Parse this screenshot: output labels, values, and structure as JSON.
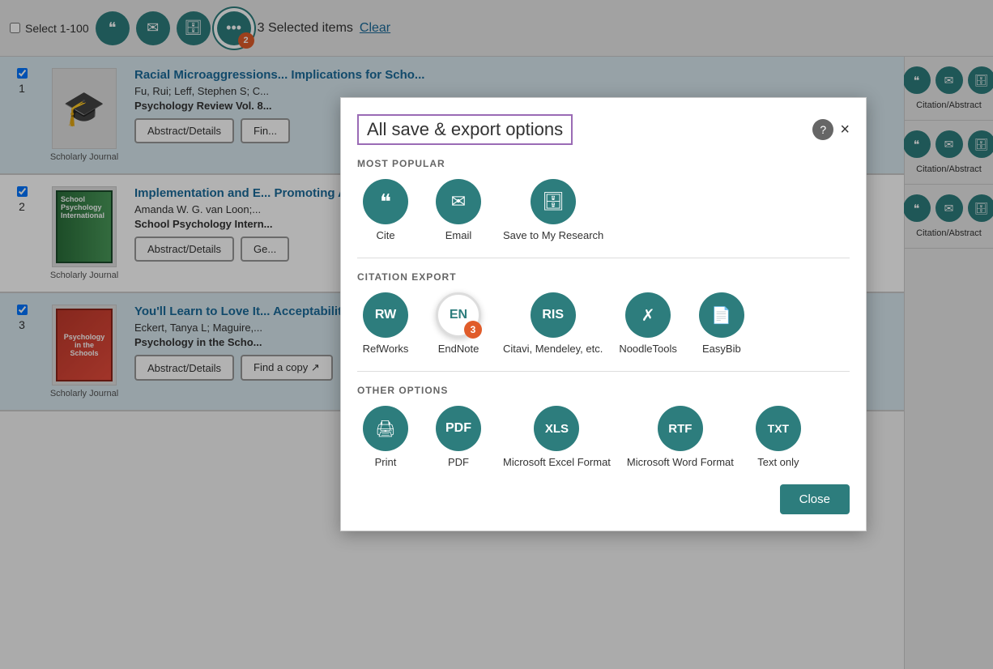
{
  "toolbar": {
    "select_label": "Select 1-100",
    "cite_icon": "❝",
    "email_icon": "✉",
    "save_icon": "🗄",
    "more_icon": "•••",
    "more_badge": "2",
    "selected_count": "3 Selected items",
    "clear_label": "Clear"
  },
  "results": [
    {
      "num": "1",
      "checked": true,
      "title": "Racial Microaggressions... Implications for Scho...",
      "authors": "Fu, Rui; Leff, Stephen S; C...",
      "source": "Psychology Review Vol. 8...",
      "type_label": "Scholarly Journal",
      "buttons": [
        "Abstract/Details",
        "Fin..."
      ]
    },
    {
      "num": "2",
      "checked": true,
      "title": "Implementation and E... Promoting Adolescen...",
      "authors": "Amanda W. G. van Loon;...",
      "source": "School Psychology Intern...",
      "type_label": "Scholarly Journal",
      "buttons": [
        "Abstract/Details",
        "Ge..."
      ]
    },
    {
      "num": "3",
      "checked": true,
      "title": "You'll Learn to Love It... Acceptability among T...",
      "authors": "Eckert, Tanya L; Maguire,...",
      "source": "Psychology in the Scho...",
      "type_label": "Scholarly Journal",
      "buttons": [
        "Abstract/Details",
        "Find a copy ↗"
      ]
    }
  ],
  "right_panel": {
    "sections": [
      {
        "label": "Citation/Abstract"
      },
      {
        "label": "Citation/Abstract"
      },
      {
        "label": "Citation/Abstract"
      }
    ]
  },
  "modal": {
    "title": "All save & export options",
    "help_icon": "?",
    "close_icon": "×",
    "most_popular_label": "MOST POPULAR",
    "citation_export_label": "CITATION EXPORT",
    "other_options_label": "OTHER OPTIONS",
    "most_popular": [
      {
        "id": "cite",
        "icon": "❝",
        "label": "Cite"
      },
      {
        "id": "email",
        "icon": "✉",
        "label": "Email"
      },
      {
        "id": "save-research",
        "icon": "🗄",
        "label": "Save to My Research"
      }
    ],
    "citation_export": [
      {
        "id": "refworks",
        "icon": "RW",
        "label": "RefWorks",
        "highlighted": false
      },
      {
        "id": "endnote",
        "icon": "EN",
        "label": "EndNote",
        "highlighted": true,
        "badge": "3"
      },
      {
        "id": "ris",
        "icon": "RIS",
        "label": "Citavi, Mendeley, etc.",
        "highlighted": false
      },
      {
        "id": "noodletools",
        "icon": "✗",
        "label": "NoodleTools",
        "highlighted": false
      },
      {
        "id": "easybib",
        "icon": "📄",
        "label": "EasyBib",
        "highlighted": false
      }
    ],
    "other_options": [
      {
        "id": "print",
        "icon": "🖨",
        "label": "Print"
      },
      {
        "id": "pdf",
        "icon": "PDF",
        "label": "PDF"
      },
      {
        "id": "excel",
        "icon": "XLS",
        "label": "Microsoft Excel Format"
      },
      {
        "id": "word",
        "icon": "RTF",
        "label": "Microsoft Word Format"
      },
      {
        "id": "text",
        "icon": "TXT",
        "label": "Text only"
      }
    ],
    "close_btn_label": "Close"
  }
}
